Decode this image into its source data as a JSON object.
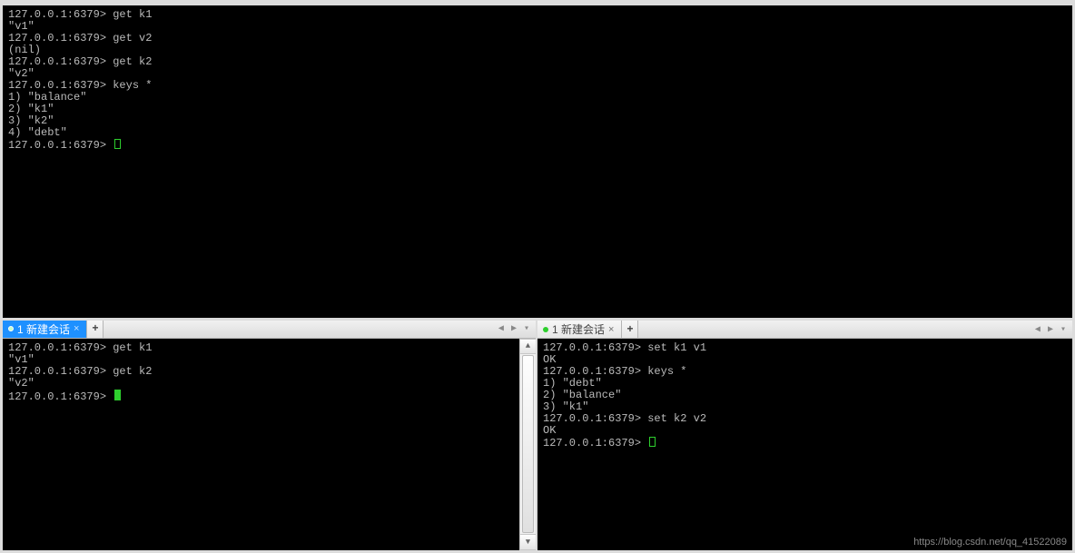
{
  "top_terminal": {
    "lines": [
      {
        "type": "cmd",
        "prompt": "127.0.0.1:6379>",
        "text": "get k1"
      },
      {
        "type": "out",
        "text": "\"v1\""
      },
      {
        "type": "cmd",
        "prompt": "127.0.0.1:6379>",
        "text": "get v2"
      },
      {
        "type": "out",
        "text": "(nil)"
      },
      {
        "type": "cmd",
        "prompt": "127.0.0.1:6379>",
        "text": "get k2"
      },
      {
        "type": "out",
        "text": "\"v2\""
      },
      {
        "type": "cmd",
        "prompt": "127.0.0.1:6379>",
        "text": "keys *"
      },
      {
        "type": "out",
        "text": "1) \"balance\""
      },
      {
        "type": "out",
        "text": "2) \"k1\""
      },
      {
        "type": "out",
        "text": "3) \"k2\""
      },
      {
        "type": "out",
        "text": "4) \"debt\""
      },
      {
        "type": "cmd",
        "prompt": "127.0.0.1:6379>",
        "text": "",
        "cursor": "hollow"
      }
    ]
  },
  "left_pane": {
    "tab": {
      "label": "1 新建会话",
      "active": true
    },
    "add_tab_label": "+",
    "lines": [
      {
        "type": "cmd",
        "prompt": "127.0.0.1:6379>",
        "text": "get k1"
      },
      {
        "type": "out",
        "text": "\"v1\""
      },
      {
        "type": "cmd",
        "prompt": "127.0.0.1:6379>",
        "text": "get k2"
      },
      {
        "type": "out",
        "text": "\"v2\""
      },
      {
        "type": "cmd",
        "prompt": "127.0.0.1:6379>",
        "text": "",
        "cursor": "solid"
      }
    ]
  },
  "right_pane": {
    "tab": {
      "label": "1 新建会话",
      "active": false
    },
    "add_tab_label": "+",
    "lines": [
      {
        "type": "cmd",
        "prompt": "127.0.0.1:6379>",
        "text": "set k1 v1"
      },
      {
        "type": "out",
        "text": "OK"
      },
      {
        "type": "cmd",
        "prompt": "127.0.0.1:6379>",
        "text": "keys *"
      },
      {
        "type": "out",
        "text": "1) \"debt\""
      },
      {
        "type": "out",
        "text": "2) \"balance\""
      },
      {
        "type": "out",
        "text": "3) \"k1\""
      },
      {
        "type": "cmd",
        "prompt": "127.0.0.1:6379>",
        "text": "set k2 v2"
      },
      {
        "type": "out",
        "text": "OK"
      },
      {
        "type": "cmd",
        "prompt": "127.0.0.1:6379>",
        "text": "",
        "cursor": "hollow"
      }
    ]
  },
  "nav_arrows": {
    "left": "◀",
    "right": "▶",
    "menu": "▾"
  },
  "scroll_arrows": {
    "up": "▲",
    "down": "▼"
  },
  "watermark": "https://blog.csdn.net/qq_41522089"
}
